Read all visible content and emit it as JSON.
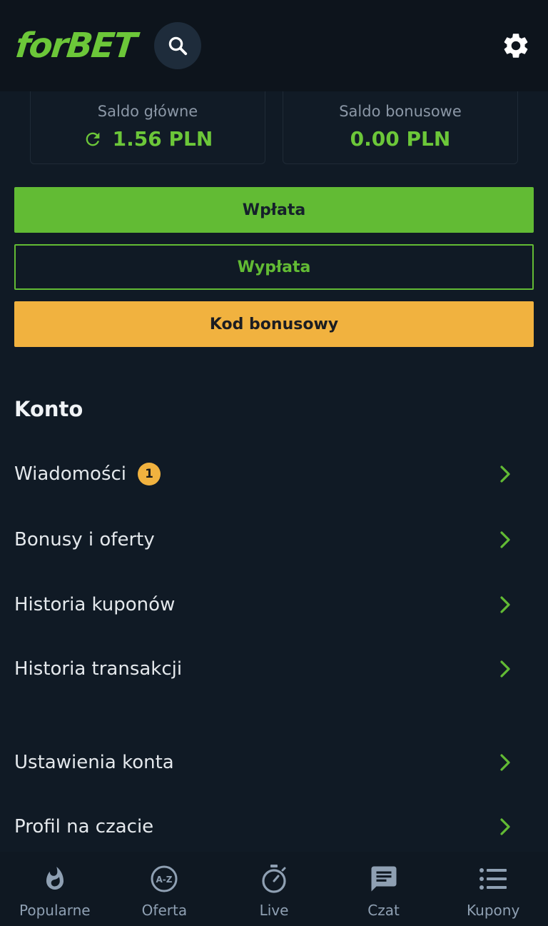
{
  "header": {
    "logo": "forBET"
  },
  "balances": {
    "main_label": "Saldo główne",
    "main_value": "1.56 PLN",
    "bonus_label": "Saldo bonusowe",
    "bonus_value": "0.00 PLN"
  },
  "actions": {
    "deposit": "Wpłata",
    "withdraw": "Wypłata",
    "bonus_code": "Kod bonusowy"
  },
  "account": {
    "title": "Konto",
    "items": [
      {
        "label": "Wiadomości",
        "badge": "1"
      },
      {
        "label": "Bonusy i oferty"
      },
      {
        "label": "Historia kuponów"
      },
      {
        "label": "Historia transakcji"
      },
      {
        "label": "Ustawienia konta"
      },
      {
        "label": "Profil na czacie"
      }
    ]
  },
  "nav": {
    "items": [
      {
        "label": "Popularne",
        "icon": "flame-icon"
      },
      {
        "label": "Oferta",
        "icon": "az-icon"
      },
      {
        "label": "Live",
        "icon": "stopwatch-icon"
      },
      {
        "label": "Czat",
        "icon": "chat-icon"
      },
      {
        "label": "Kupony",
        "icon": "list-icon"
      }
    ]
  },
  "colors": {
    "brand_green": "#62bb34",
    "accent_yellow": "#f1b23f",
    "background": "#101a25"
  }
}
